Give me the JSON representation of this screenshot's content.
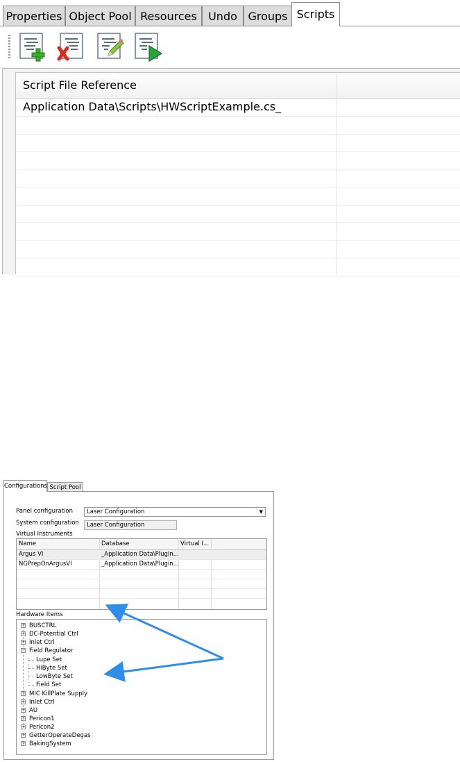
{
  "top_panel": {
    "tabs": [
      "Properties",
      "Object Pool",
      "Resources",
      "Undo",
      "Groups",
      "Scripts"
    ],
    "active_tab": "Scripts",
    "toolbar": {
      "buttons": [
        "add-script-icon",
        "remove-script-icon",
        "edit-script-icon",
        "run-script-icon"
      ]
    },
    "grid": {
      "column_header": "Script File Reference",
      "rows": [
        "Application Data\\Scripts\\HWScriptExample.cs_",
        "",
        "",
        "",
        "",
        "",
        "",
        "",
        "",
        ""
      ]
    }
  },
  "bottom_panel": {
    "tabs": [
      "Configurations",
      "Script Pool"
    ],
    "active_tab": "Configurations",
    "panel_configuration_label": "Panel configuration",
    "panel_configuration_value": "Laser Configuration",
    "system_configuration_label": "System configuration",
    "system_configuration_value": "Laser Configuration",
    "virtual_instruments_label": "Virtual Instruments",
    "vi_columns": [
      "Name",
      "Database",
      "Virtual I..."
    ],
    "vi_rows": [
      {
        "name": "Argus VI",
        "database": "_Application Data\\Plugin..."
      },
      {
        "name": "NGPrepOnArgusVI",
        "database": "_Application Data\\Plugin..."
      }
    ],
    "hardware_items_label": "Hardware Items",
    "tree": [
      {
        "label": "BUSCTRL",
        "expanded": false
      },
      {
        "label": "DC-Potential Ctrl",
        "expanded": false
      },
      {
        "label": "Inlet Ctrl",
        "expanded": false
      },
      {
        "label": "Field Regulator",
        "expanded": true,
        "children": [
          "Lupe Set",
          "HiByte Set",
          "LowByte Set",
          "Field Set"
        ]
      },
      {
        "label": "MIC KillPlate Supply",
        "expanded": false
      },
      {
        "label": "Inlet Ctrl",
        "expanded": false
      },
      {
        "label": "AU",
        "expanded": false
      },
      {
        "label": "Pericon1",
        "expanded": false
      },
      {
        "label": "Pericon2",
        "expanded": false
      },
      {
        "label": "GetterOperateDegas",
        "expanded": false
      },
      {
        "label": "BakingSystem",
        "expanded": false
      }
    ]
  },
  "colors": {
    "tab_inactive": "#dcdcdc",
    "arrow": "#2e8ee8",
    "add_green": "#3cae2c",
    "remove_red": "#d92b1f",
    "run_green": "#27a53a"
  }
}
